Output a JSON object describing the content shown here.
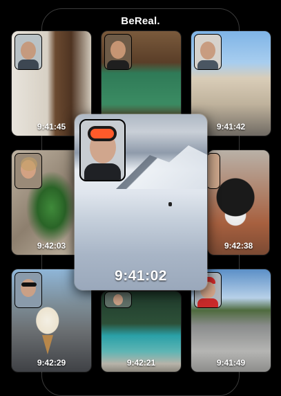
{
  "app": {
    "title": "BeReal."
  },
  "featured": {
    "time": "9:41:02"
  },
  "posts": [
    {
      "time": "9:41:45"
    },
    {
      "time": "9:41:42"
    },
    {
      "time": "9:42:03"
    },
    {
      "time": "9:42:38"
    },
    {
      "time": "9:42:29"
    },
    {
      "time": "9:42:21"
    },
    {
      "time": "9:41:49"
    }
  ]
}
